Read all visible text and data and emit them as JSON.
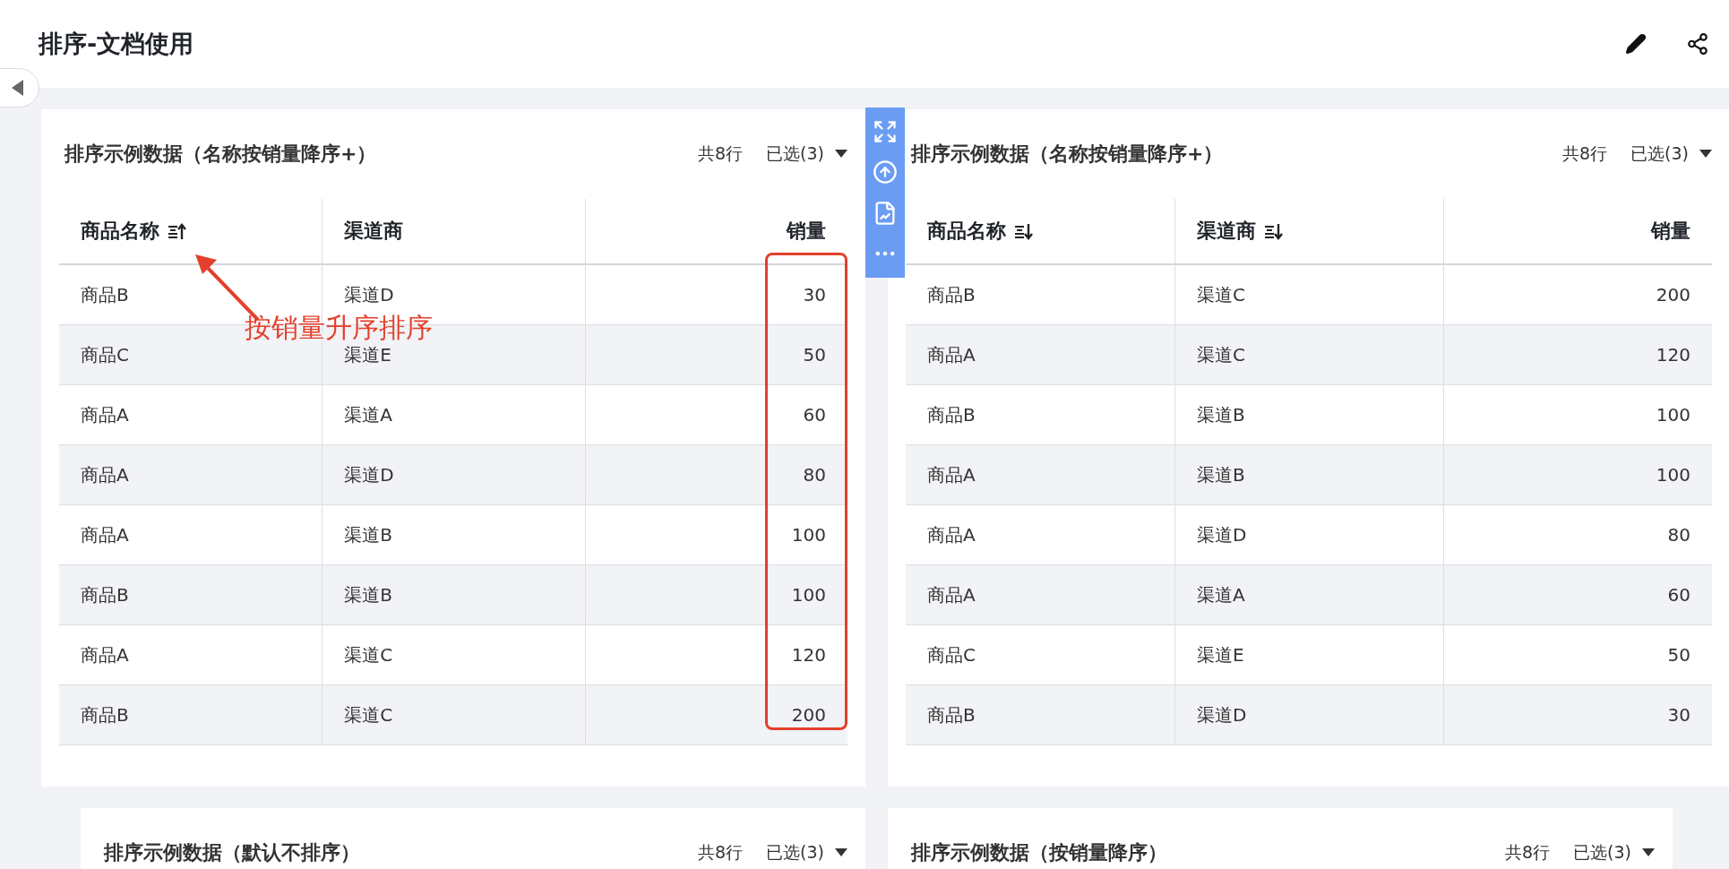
{
  "page": {
    "title": "排序-文档使用"
  },
  "cards": [
    {
      "title": "排序示例数据（名称按销量降序+）",
      "row_count": "共8行",
      "selection": "已选(3)",
      "columns": [
        {
          "label": "商品名称",
          "sorted": true,
          "descending": false
        },
        {
          "label": "渠道商",
          "sorted": false
        },
        {
          "label": "销量",
          "sorted": false
        }
      ],
      "rows": [
        [
          "商品B",
          "渠道D",
          "30"
        ],
        [
          "商品C",
          "渠道E",
          "50"
        ],
        [
          "商品A",
          "渠道A",
          "60"
        ],
        [
          "商品A",
          "渠道D",
          "80"
        ],
        [
          "商品A",
          "渠道B",
          "100"
        ],
        [
          "商品B",
          "渠道B",
          "100"
        ],
        [
          "商品A",
          "渠道C",
          "120"
        ],
        [
          "商品B",
          "渠道C",
          "200"
        ]
      ],
      "annotation": {
        "text": "按销量升序排序"
      }
    },
    {
      "title": "排序示例数据（名称按销量降序+）",
      "row_count": "共8行",
      "selection": "已选(3)",
      "columns": [
        {
          "label": "商品名称",
          "sorted": true,
          "descending": true
        },
        {
          "label": "渠道商",
          "sorted": true,
          "descending": true
        },
        {
          "label": "销量",
          "sorted": false
        }
      ],
      "rows": [
        [
          "商品B",
          "渠道C",
          "200"
        ],
        [
          "商品A",
          "渠道C",
          "120"
        ],
        [
          "商品B",
          "渠道B",
          "100"
        ],
        [
          "商品A",
          "渠道B",
          "100"
        ],
        [
          "商品A",
          "渠道D",
          "80"
        ],
        [
          "商品A",
          "渠道A",
          "60"
        ],
        [
          "商品C",
          "渠道E",
          "50"
        ],
        [
          "商品B",
          "渠道D",
          "30"
        ]
      ]
    },
    {
      "title": "排序示例数据（默认不排序）",
      "row_count": "共8行",
      "selection": "已选(3)"
    },
    {
      "title": "排序示例数据（按销量降序）",
      "row_count": "共8行",
      "selection": "已选(3)"
    }
  ]
}
